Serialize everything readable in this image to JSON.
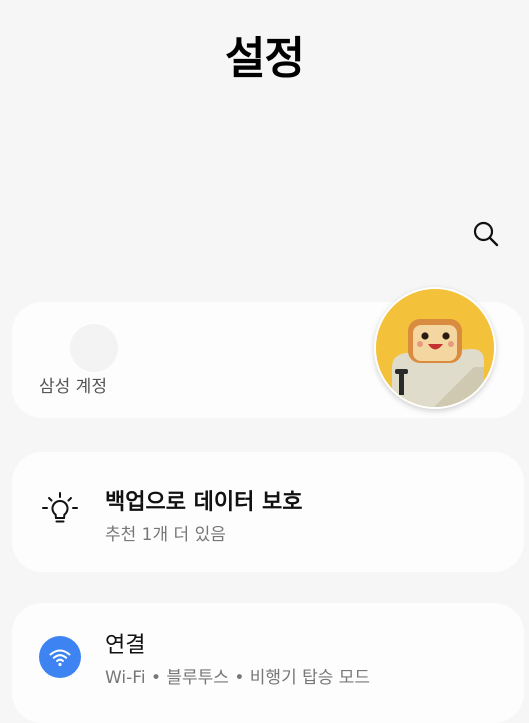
{
  "header": {
    "title": "설정"
  },
  "search": {
    "icon": "search-icon"
  },
  "account": {
    "label": "삼성 계정",
    "avatar_icon": "toast-character-avatar"
  },
  "suggestion": {
    "icon": "lightbulb-icon",
    "title": "백업으로 데이터 보호",
    "subtitle": "추천 1개 더 있음"
  },
  "connections": {
    "icon": "wifi-icon",
    "icon_color": "#3e83f2",
    "title": "연결",
    "subtitle": "Wi-Fi  •  블루투스  •  비행기 탑승 모드"
  }
}
